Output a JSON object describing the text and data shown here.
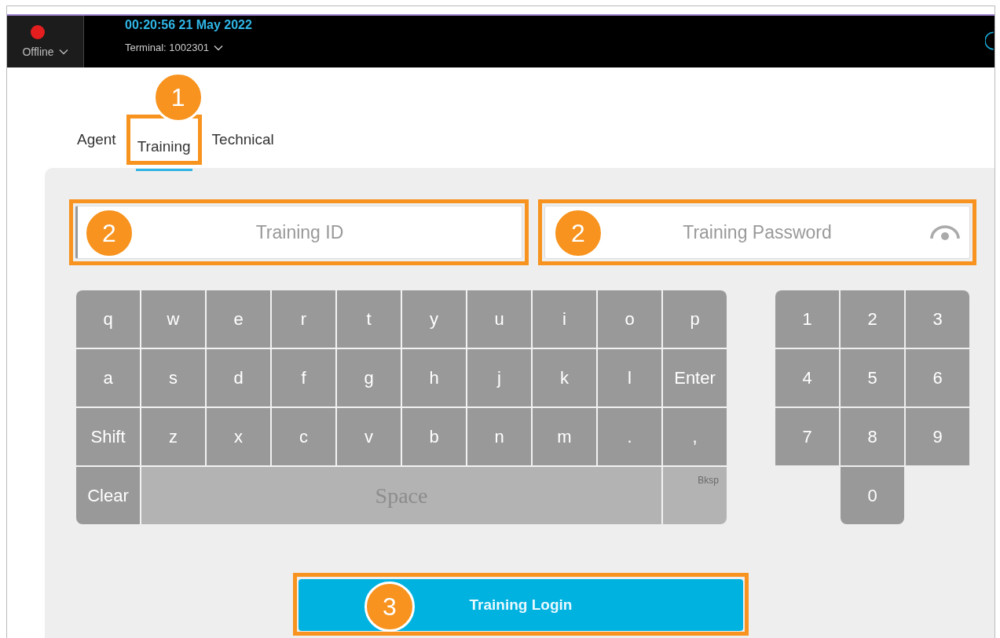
{
  "header": {
    "status": "Offline",
    "online": false,
    "datetime": "00:20:56 21 May 2022",
    "terminal": "Terminal: 1002301"
  },
  "tabs": [
    {
      "label": "Agent",
      "selected": false
    },
    {
      "label": "Training",
      "selected": true,
      "callout": "1"
    },
    {
      "label": "Technical",
      "selected": false
    }
  ],
  "fields": [
    {
      "placeholder": "Training ID",
      "kind": "text",
      "callout": "2"
    },
    {
      "placeholder": "Training Password",
      "kind": "password",
      "callout": "2"
    }
  ],
  "keyboard": [
    [
      {
        "label": "q",
        "kind": "key"
      },
      {
        "label": "w",
        "kind": "key"
      },
      {
        "label": "e",
        "kind": "key"
      },
      {
        "label": "r",
        "kind": "key"
      },
      {
        "label": "t",
        "kind": "key"
      },
      {
        "label": "y",
        "kind": "key"
      },
      {
        "label": "u",
        "kind": "key"
      },
      {
        "label": "i",
        "kind": "key"
      },
      {
        "label": "o",
        "kind": "key"
      },
      {
        "label": "p",
        "kind": "key"
      }
    ],
    [
      {
        "label": "a",
        "kind": "key"
      },
      {
        "label": "s",
        "kind": "key"
      },
      {
        "label": "d",
        "kind": "key"
      },
      {
        "label": "f",
        "kind": "key"
      },
      {
        "label": "g",
        "kind": "key"
      },
      {
        "label": "h",
        "kind": "key"
      },
      {
        "label": "j",
        "kind": "key"
      },
      {
        "label": "k",
        "kind": "key"
      },
      {
        "label": "l",
        "kind": "key"
      },
      {
        "label": "Enter",
        "kind": "key"
      }
    ],
    [
      {
        "label": "Shift",
        "kind": "key"
      },
      {
        "label": "z",
        "kind": "key"
      },
      {
        "label": "x",
        "kind": "key"
      },
      {
        "label": "c",
        "kind": "key"
      },
      {
        "label": "v",
        "kind": "key"
      },
      {
        "label": "b",
        "kind": "key"
      },
      {
        "label": "n",
        "kind": "key"
      },
      {
        "label": "m",
        "kind": "key"
      },
      {
        "label": ".",
        "kind": "key"
      },
      {
        "label": ",",
        "kind": "key"
      }
    ],
    [
      {
        "label": "Clear",
        "kind": "key"
      },
      {
        "label": "Space",
        "kind": "space"
      },
      {
        "label": "Bksp",
        "kind": "bksp"
      }
    ]
  ],
  "numpad": [
    [
      "1",
      "2",
      "3"
    ],
    [
      "4",
      "5",
      "6"
    ],
    [
      "7",
      "8",
      "9"
    ],
    [
      "0"
    ]
  ],
  "login": {
    "label": "Training Login",
    "callout": "3"
  }
}
